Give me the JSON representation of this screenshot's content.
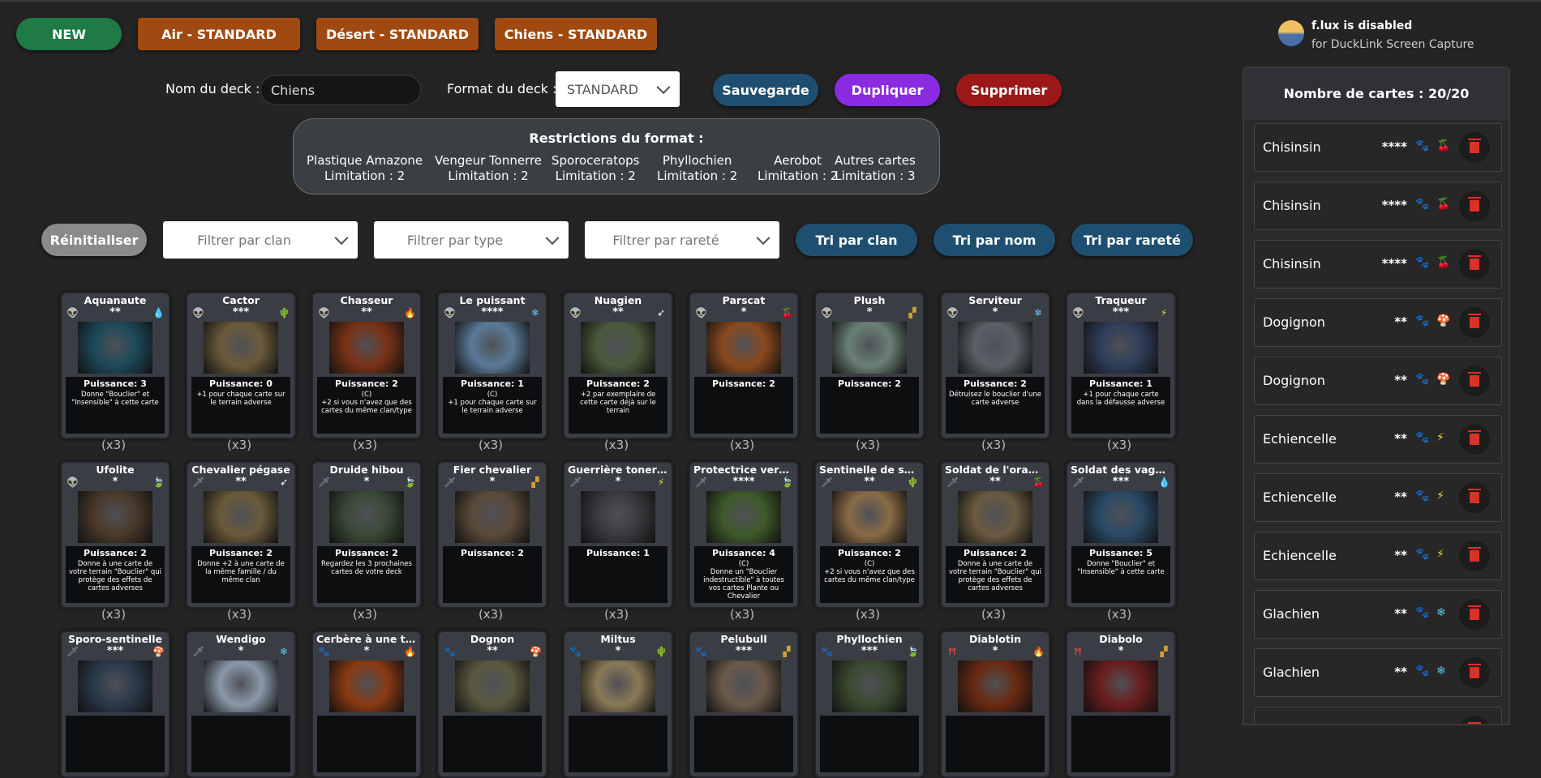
{
  "topbar": {
    "new_label": "NEW",
    "tabs": [
      "Air - STANDARD",
      "Désert - STANDARD",
      "Chiens - STANDARD"
    ]
  },
  "deck": {
    "name_label": "Nom du deck :",
    "name_value": "Chiens",
    "format_label": "Format du deck :",
    "format_value": "STANDARD",
    "save_label": "Sauvegarde",
    "duplicate_label": "Dupliquer",
    "delete_label": "Supprimer"
  },
  "restrictions": {
    "title": "Restrictions du format :",
    "items": [
      {
        "name": "Plastique Amazone",
        "limit": "Limitation : 2"
      },
      {
        "name": "Vengeur Tonnerre",
        "limit": "Limitation : 2"
      },
      {
        "name": "Sporoceratops",
        "limit": "Limitation : 2"
      },
      {
        "name": "Phyllochien",
        "limit": "Limitation : 2"
      },
      {
        "name": "Aerobot",
        "limit": "Limitation : 2"
      },
      {
        "name": "Autres cartes",
        "limit": "Limitation : 3"
      }
    ]
  },
  "filters": {
    "reset_label": "Réinitialiser",
    "clan_placeholder": "Filtrer par clan",
    "type_placeholder": "Filtrer par type",
    "rarity_placeholder": "Filtrer par rareté",
    "sort_clan": "Tri par clan",
    "sort_name": "Tri par nom",
    "sort_rarity": "Tri par rareté"
  },
  "colors": {
    "new": "#1f7a45",
    "tab": "#a04a12",
    "save": "#1f4f70",
    "duplicate": "#8a2be2",
    "delete": "#9c1818",
    "reset": "#8a8a8a"
  },
  "cards": [
    {
      "name": "Aquanaute",
      "stars": "**",
      "clan": "alien-icon",
      "type": "water-icon",
      "power": "Puissance: 3",
      "desc": "Donne \"Bouclier\" et \"Insensible\" à cette carte",
      "qty": "(x3)",
      "art": "#1d4a5a"
    },
    {
      "name": "Cactor",
      "stars": "***",
      "clan": "alien-icon",
      "type": "cactus-icon",
      "power": "Puissance: 0",
      "desc": "+1 pour chaque carte sur le terrain adverse",
      "qty": "(x3)",
      "art": "#6a5a3a"
    },
    {
      "name": "Chasseur",
      "stars": "**",
      "clan": "alien-icon",
      "type": "fire-icon",
      "power": "Puissance: 2",
      "desc": "(C)\n+2 si vous n'avez que des cartes du même clan/type",
      "qty": "(x3)",
      "art": "#7a3216"
    },
    {
      "name": "Le puissant",
      "stars": "****",
      "clan": "alien-icon",
      "type": "snow-icon",
      "power": "Puissance: 1",
      "desc": "(C)\n+1 pour chaque carte sur le terrain adverse",
      "qty": "(x3)",
      "art": "#5a7a96"
    },
    {
      "name": "Nuagien",
      "stars": "**",
      "clan": "alien-icon",
      "type": "wing-icon",
      "power": "Puissance: 2",
      "desc": "+2 par exemplaire de cette carte déjà sur le terrain",
      "qty": "(x3)",
      "art": "#4a5a3c"
    },
    {
      "name": "Parscat",
      "stars": "*",
      "clan": "alien-icon",
      "type": "cherry-icon",
      "power": "Puissance: 2",
      "desc": "",
      "qty": "(x3)",
      "art": "#8a4a1e"
    },
    {
      "name": "Plush",
      "stars": "*",
      "clan": "alien-icon",
      "type": "toy-icon",
      "power": "Puissance: 2",
      "desc": "",
      "qty": "(x3)",
      "art": "#6a8076"
    },
    {
      "name": "Serviteur",
      "stars": "*",
      "clan": "alien-icon",
      "type": "snow-icon",
      "power": "Puissance: 2",
      "desc": "Détruisez le bouclier d'une carte adverse",
      "qty": "(x3)",
      "art": "#5a6066"
    },
    {
      "name": "Traqueur",
      "stars": "***",
      "clan": "alien-icon",
      "type": "bolt-icon",
      "power": "Puissance: 1",
      "desc": "+1 pour chaque carte dans la défausse adverse",
      "qty": "(x3)",
      "art": "#2e3e5a"
    },
    {
      "name": "Ufolite",
      "stars": "*",
      "clan": "alien-icon",
      "type": "leaf-icon",
      "power": "Puissance: 2",
      "desc": "Donne à une carte de votre terrain \"Bouclier\" qui protège des effets de cartes adverses",
      "qty": "(x3)",
      "art": "#4a3a2a"
    },
    {
      "name": "Chevalier pégase",
      "stars": "**",
      "clan": "sword-icon",
      "type": "wing-icon",
      "power": "Puissance: 2",
      "desc": "Donne +2 à une carte de la même famille / du même clan",
      "qty": "(x3)",
      "art": "#6a5a3a"
    },
    {
      "name": "Druide hibou",
      "stars": "*",
      "clan": "sword-icon",
      "type": "leaf-icon",
      "power": "Puissance: 2",
      "desc": "Regardez les 3 prochaines cartes de votre deck",
      "qty": "(x3)",
      "art": "#3a4a36"
    },
    {
      "name": "Fier chevalier",
      "stars": "*",
      "clan": "sword-icon",
      "type": "toy-icon",
      "power": "Puissance: 2",
      "desc": "",
      "qty": "(x3)",
      "art": "#5a4a3a"
    },
    {
      "name": "Guerrière tonerre",
      "stars": "*",
      "clan": "sword-icon",
      "type": "bolt-icon",
      "power": "Puissance: 1",
      "desc": "",
      "qty": "(x3)",
      "art": "#3a3a3e"
    },
    {
      "name": "Protectrice verdoyante",
      "stars": "****",
      "clan": "sword-icon",
      "type": "leaf-icon",
      "power": "Puissance: 4",
      "desc": "(C)\nDonne un \"Bouclier indestructible\" à toutes vos cartes Plante ou Chevalier",
      "qty": "(x3)",
      "art": "#3e5a2a"
    },
    {
      "name": "Sentinelle de sable",
      "stars": "**",
      "clan": "sword-icon",
      "type": "cactus-icon",
      "power": "Puissance: 2",
      "desc": "(C)\n+2 si vous n'avez que des cartes du même clan/type",
      "qty": "(x3)",
      "art": "#8a6a46"
    },
    {
      "name": "Soldat de l'orange",
      "stars": "**",
      "clan": "sword-icon",
      "type": "cherry-icon",
      "power": "Puissance: 2",
      "desc": "Donne à une carte de votre terrain \"Bouclier\" qui protège des effets de cartes adverses",
      "qty": "(x3)",
      "art": "#6a5a40"
    },
    {
      "name": "Soldat des vagues",
      "stars": "***",
      "clan": "sword-icon",
      "type": "water-icon",
      "power": "Puissance: 5",
      "desc": "Donne \"Bouclier\" et \"Insensible\" à cette carte",
      "qty": "(x3)",
      "art": "#2a4a66"
    },
    {
      "name": "Sporo-sentinelle",
      "stars": "***",
      "clan": "sword-icon",
      "type": "mushroom-icon",
      "power": "",
      "desc": "",
      "qty": "",
      "art": "#2a3a4a"
    },
    {
      "name": "Wendigo",
      "stars": "*",
      "clan": "sword-icon",
      "type": "snow-icon",
      "power": "",
      "desc": "",
      "qty": "",
      "art": "#8a9aaa"
    },
    {
      "name": "Cerbère à une tête",
      "stars": "*",
      "clan": "paw-icon",
      "type": "fire-icon",
      "power": "",
      "desc": "",
      "qty": "",
      "art": "#8a3a12"
    },
    {
      "name": "Dognon",
      "stars": "**",
      "clan": "paw-icon",
      "type": "mushroom-icon",
      "power": "",
      "desc": "",
      "qty": "",
      "art": "#5a5a40"
    },
    {
      "name": "Miltus",
      "stars": "*",
      "clan": "paw-icon",
      "type": "cactus-icon",
      "power": "",
      "desc": "",
      "qty": "",
      "art": "#8a7a56"
    },
    {
      "name": "Pelubull",
      "stars": "***",
      "clan": "paw-icon",
      "type": "toy-icon",
      "power": "",
      "desc": "",
      "qty": "",
      "art": "#6a5a4a"
    },
    {
      "name": "Phyllochien",
      "stars": "***",
      "clan": "paw-icon",
      "type": "leaf-icon",
      "power": "",
      "desc": "",
      "qty": "",
      "art": "#3a4a30"
    },
    {
      "name": "Diablotin",
      "stars": "*",
      "clan": "horn-icon",
      "type": "fire-icon",
      "power": "",
      "desc": "",
      "qty": "",
      "art": "#6a2a12"
    },
    {
      "name": "Diabolo",
      "stars": "*",
      "clan": "horn-icon",
      "type": "toy-icon",
      "power": "",
      "desc": "",
      "qty": "",
      "art": "#6a1e1e"
    }
  ],
  "panel": {
    "count_label": "Nombre de cartes : 20/20",
    "rows": [
      {
        "name": "Chisinsin",
        "stars": "****",
        "type": "cherry-icon"
      },
      {
        "name": "Chisinsin",
        "stars": "****",
        "type": "cherry-icon"
      },
      {
        "name": "Chisinsin",
        "stars": "****",
        "type": "cherry-icon"
      },
      {
        "name": "Dogignon",
        "stars": "**",
        "type": "mushroom-icon"
      },
      {
        "name": "Dogignon",
        "stars": "**",
        "type": "mushroom-icon"
      },
      {
        "name": "Echiencelle",
        "stars": "**",
        "type": "bolt-icon"
      },
      {
        "name": "Echiencelle",
        "stars": "**",
        "type": "bolt-icon"
      },
      {
        "name": "Echiencelle",
        "stars": "**",
        "type": "bolt-icon"
      },
      {
        "name": "Glachien",
        "stars": "**",
        "type": "snow-icon"
      },
      {
        "name": "Glachien",
        "stars": "**",
        "type": "snow-icon"
      },
      {
        "name": "",
        "stars": "",
        "type": ""
      }
    ]
  },
  "flux": {
    "title": "f.lux is disabled",
    "subtitle": "for DuckLink Screen Capture"
  }
}
